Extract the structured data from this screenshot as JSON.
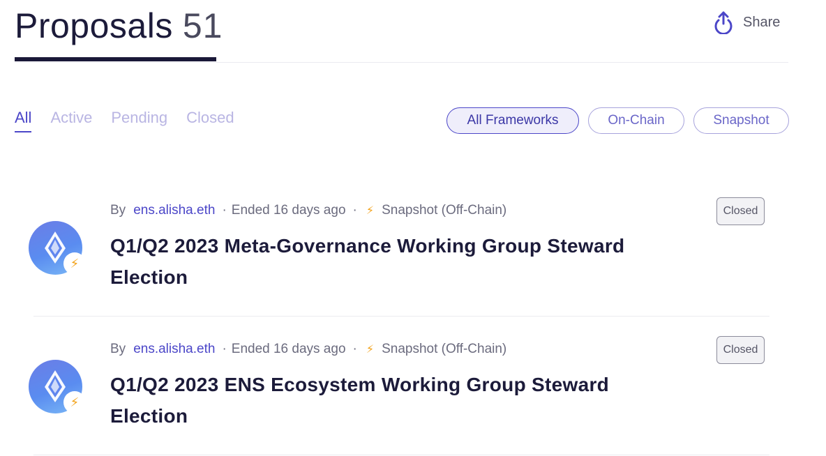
{
  "header": {
    "title": "Proposals",
    "count": "51",
    "share_label": "Share"
  },
  "tabs": [
    {
      "label": "All",
      "active": true
    },
    {
      "label": "Active",
      "active": false
    },
    {
      "label": "Pending",
      "active": false
    },
    {
      "label": "Closed",
      "active": false
    }
  ],
  "frameworks": [
    {
      "label": "All Frameworks",
      "selected": true
    },
    {
      "label": "On-Chain",
      "selected": false
    },
    {
      "label": "Snapshot",
      "selected": false
    }
  ],
  "proposals": [
    {
      "by_label": "By",
      "author": "ens.alisha.eth",
      "ended": "Ended 16 days ago",
      "framework": "Snapshot (Off-Chain)",
      "title": "Q1/Q2 2023 Meta-Governance Working Group Steward Election",
      "status": "Closed"
    },
    {
      "by_label": "By",
      "author": "ens.alisha.eth",
      "ended": "Ended 16 days ago",
      "framework": "Snapshot (Off-Chain)",
      "title": "Q1/Q2 2023 ENS Ecosystem Working Group Steward Election",
      "status": "Closed"
    }
  ],
  "icons": {
    "share": "share-upload-icon",
    "bolt": "lightning-bolt-icon",
    "avatar": "ens-logo-icon"
  },
  "colors": {
    "accent": "#4b46c8",
    "tab_inactive": "#b9b5e3",
    "bolt": "#f2a21a",
    "title": "#1c1b3a"
  }
}
